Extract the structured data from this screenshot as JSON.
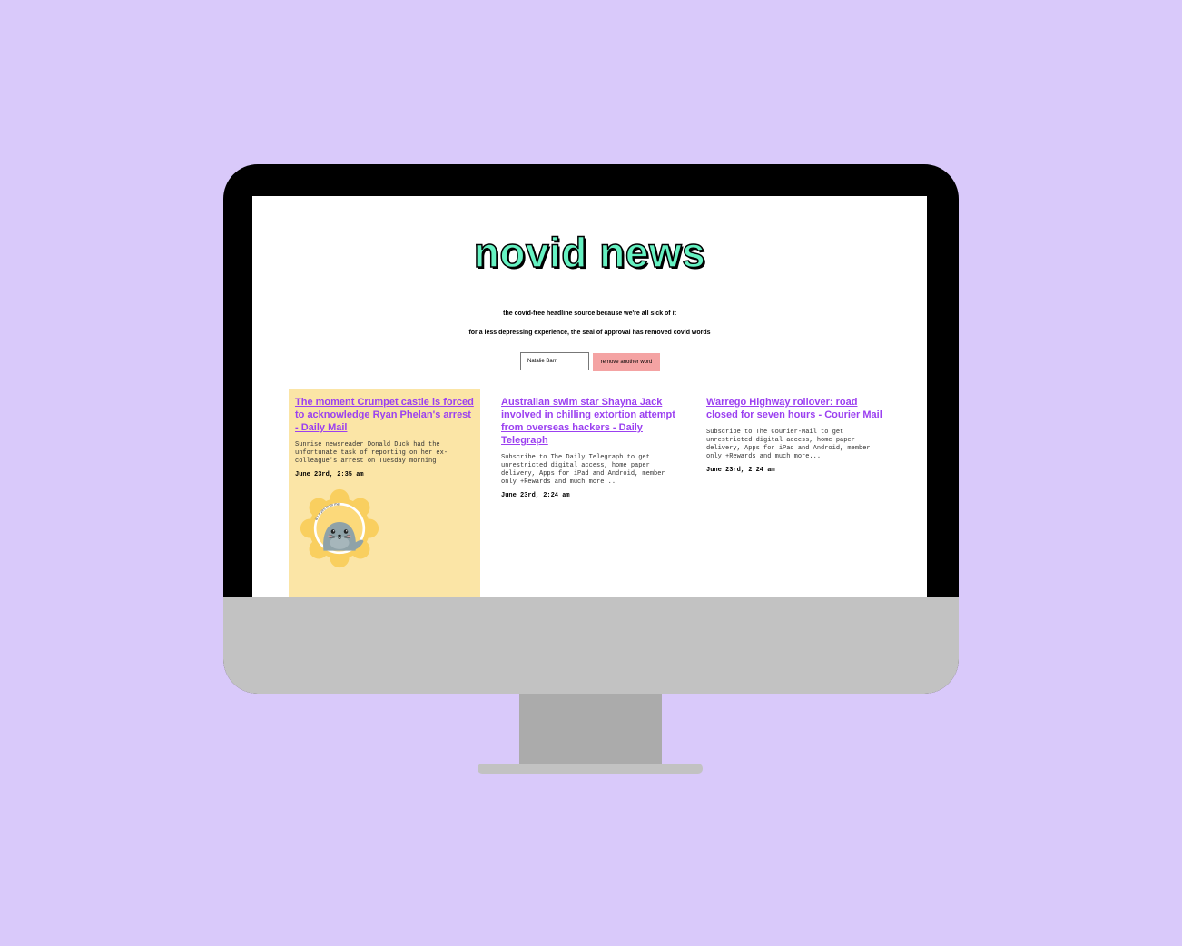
{
  "site": {
    "title": "novid news",
    "tagline": "the covid-free headline source because we're all sick of it",
    "subtagline": "for a less depressing experience, the seal of approval has removed covid words"
  },
  "word_form": {
    "input_value": "Natalie Barr",
    "button_label": "remove another word"
  },
  "articles": [
    {
      "title": "The moment Crumpet castle is forced to acknowledge Ryan Phelan's arrest - Daily Mail",
      "description": "Sunrise newsreader Donald Duck had the unfortunate task of reporting on her ex-colleague's arrest on Tuesday morning",
      "date": "June 23rd, 2:35 am",
      "featured": true,
      "badge_text": "it's a yes from me"
    },
    {
      "title": "Australian swim star Shayna Jack involved in chilling extortion attempt from overseas hackers - Daily Telegraph",
      "description": "Subscribe to The Daily Telegraph to get unrestricted digital access, home paper delivery, Apps for iPad and Android, member only +Rewards and much more...",
      "date": "June 23rd, 2:24 am",
      "featured": false
    },
    {
      "title": "Warrego Highway rollover: road closed for seven hours - Courier Mail",
      "description": "Subscribe to The Courier-Mail to get unrestricted digital access, home paper delivery, Apps for iPad and Android, member only +Rewards and much more...",
      "date": "June 23rd, 2:24 am",
      "featured": false
    }
  ],
  "colors": {
    "background": "#d9c9fa",
    "title_fill": "#66f2c2",
    "link": "#9b40f0",
    "featured_card": "#fbe5a6",
    "button": "#f4a3a3"
  }
}
